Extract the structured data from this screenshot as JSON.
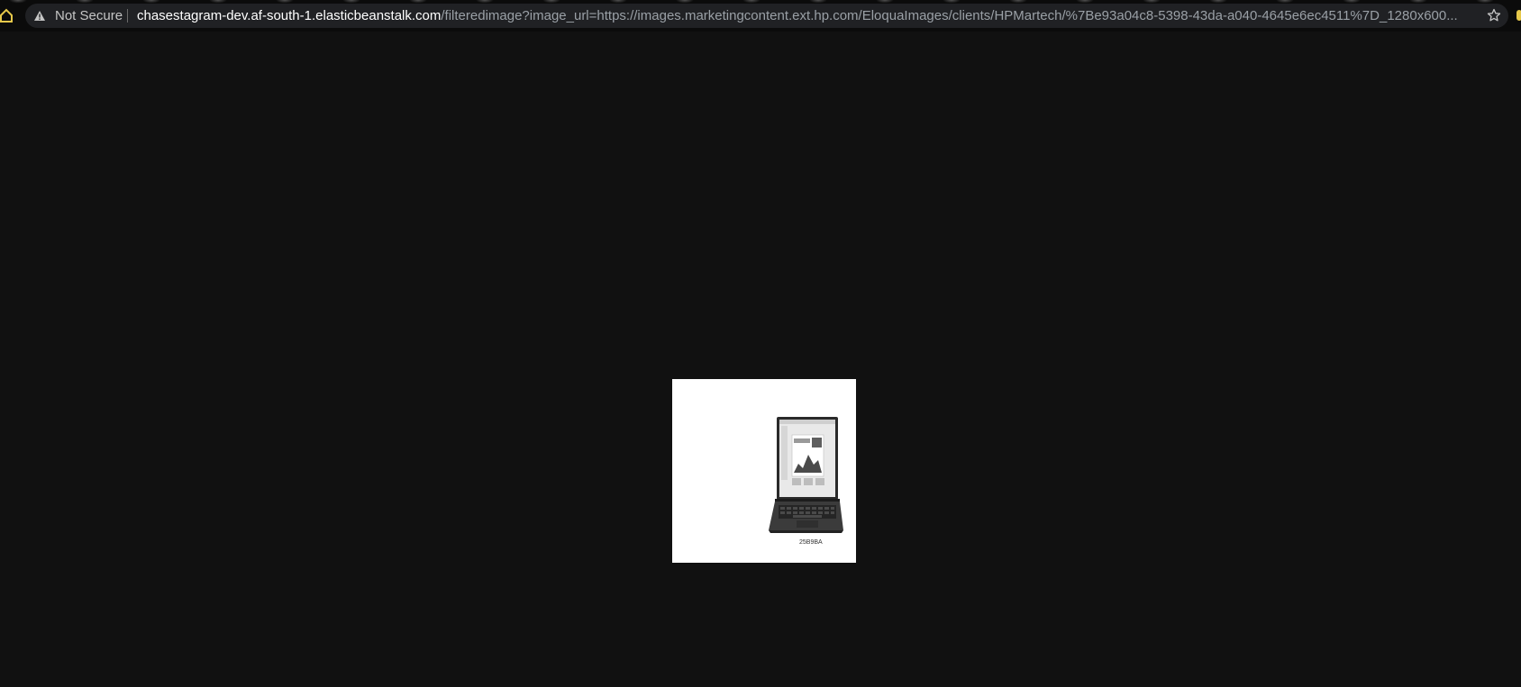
{
  "browser": {
    "security_label": "Not Secure",
    "url_host": "chasestagram-dev.af-south-1.elasticbeanstalk.com",
    "url_path": "/filteredimage?image_url=https://images.marketingcontent.ext.hp.com/EloquaImages/clients/HPMartech/%7Be93a04c8-5398-43da-a040-4645e6ec4511%7D_1280x600...",
    "icons": {
      "home": "home-icon",
      "warning": "warning-icon",
      "bookmark": "star-icon",
      "extension": "extension-icon"
    }
  },
  "page": {
    "background_color": "#111111",
    "image": {
      "subject": "laptop",
      "caption": "25B9BA"
    }
  },
  "colors": {
    "home_icon": "#e6c84a",
    "url_host": "#ffffff",
    "url_path": "#9aa0a6",
    "omnibox": "#202124"
  }
}
